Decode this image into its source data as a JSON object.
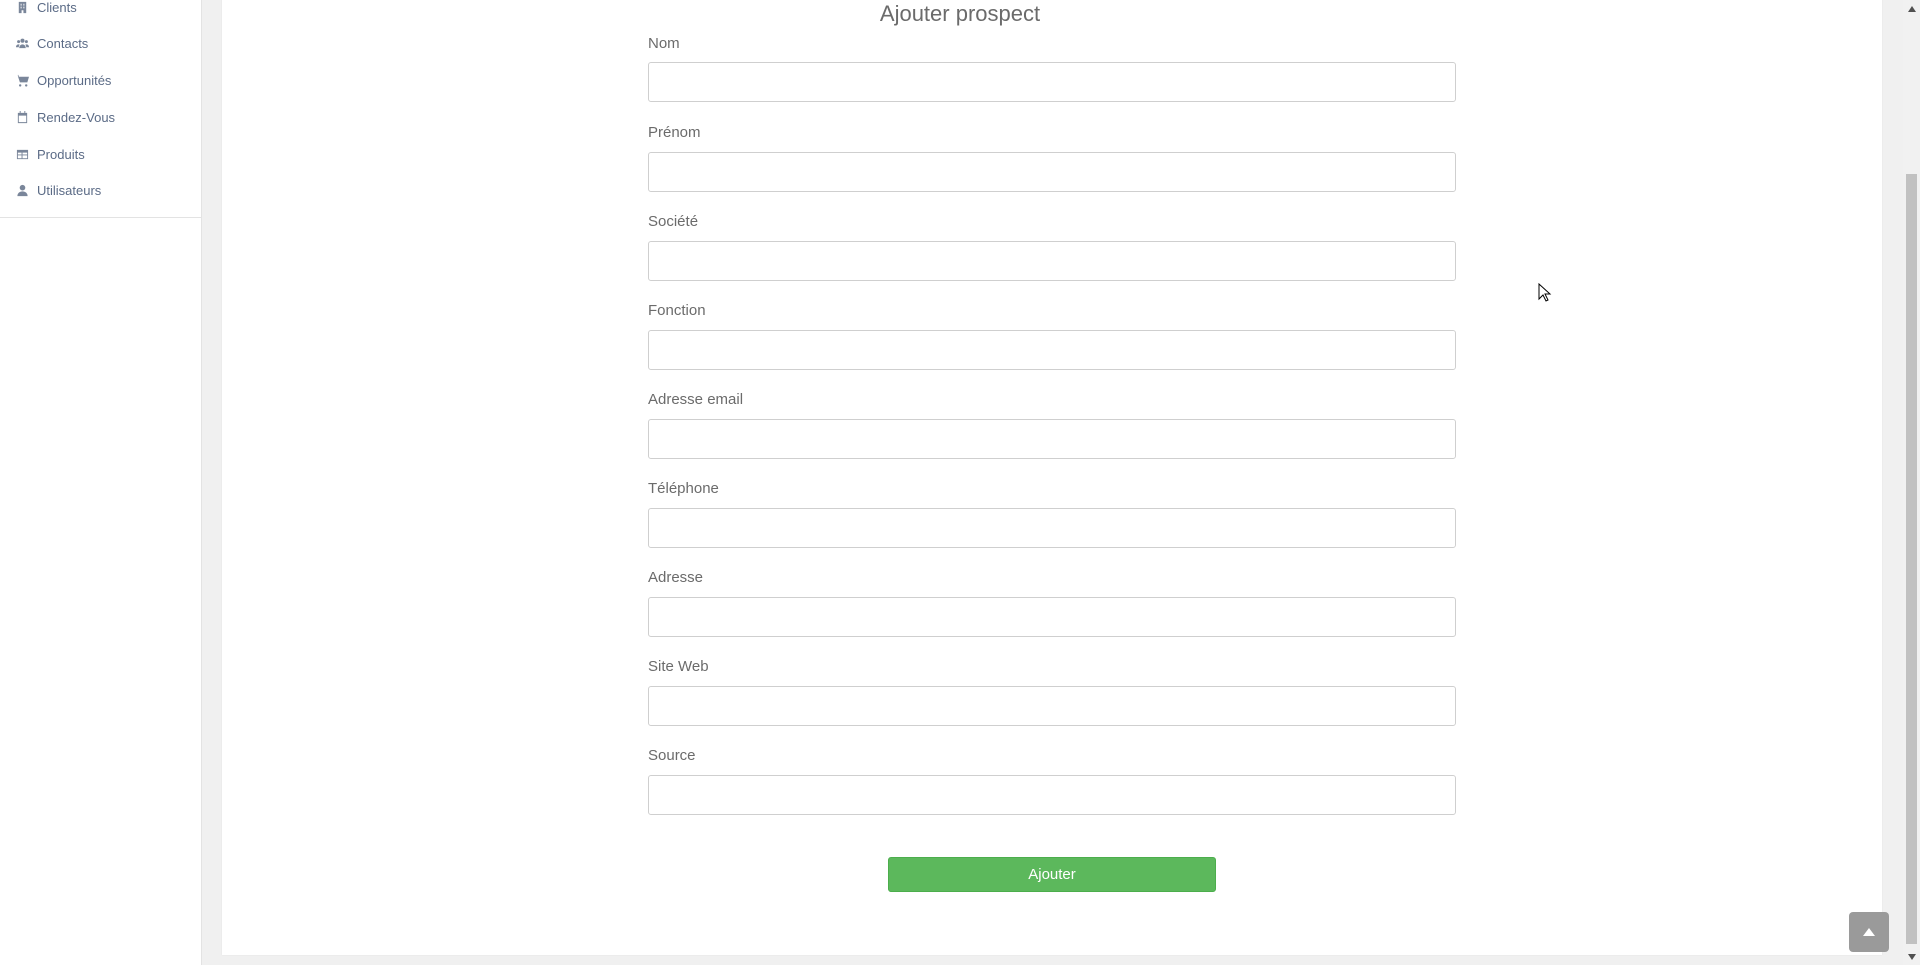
{
  "sidebar": {
    "items": [
      {
        "label": "Clients",
        "icon": "building-icon"
      },
      {
        "label": "Contacts",
        "icon": "users-icon"
      },
      {
        "label": "Opportunités",
        "icon": "cart-icon"
      },
      {
        "label": "Rendez-Vous",
        "icon": "calendar-icon"
      },
      {
        "label": "Produits",
        "icon": "table-icon"
      },
      {
        "label": "Utilisateurs",
        "icon": "user-icon"
      }
    ]
  },
  "form": {
    "title": "Ajouter prospect",
    "fields": [
      {
        "label": "Nom",
        "value": ""
      },
      {
        "label": "Prénom",
        "value": ""
      },
      {
        "label": "Société",
        "value": ""
      },
      {
        "label": "Fonction",
        "value": ""
      },
      {
        "label": "Adresse email",
        "value": ""
      },
      {
        "label": "Téléphone",
        "value": ""
      },
      {
        "label": "Adresse",
        "value": ""
      },
      {
        "label": "Site Web",
        "value": ""
      },
      {
        "label": "Source",
        "value": ""
      }
    ],
    "submit_label": "Ajouter"
  },
  "colors": {
    "submit": "#5cb85c",
    "sidebar_text": "#5b6b86"
  }
}
